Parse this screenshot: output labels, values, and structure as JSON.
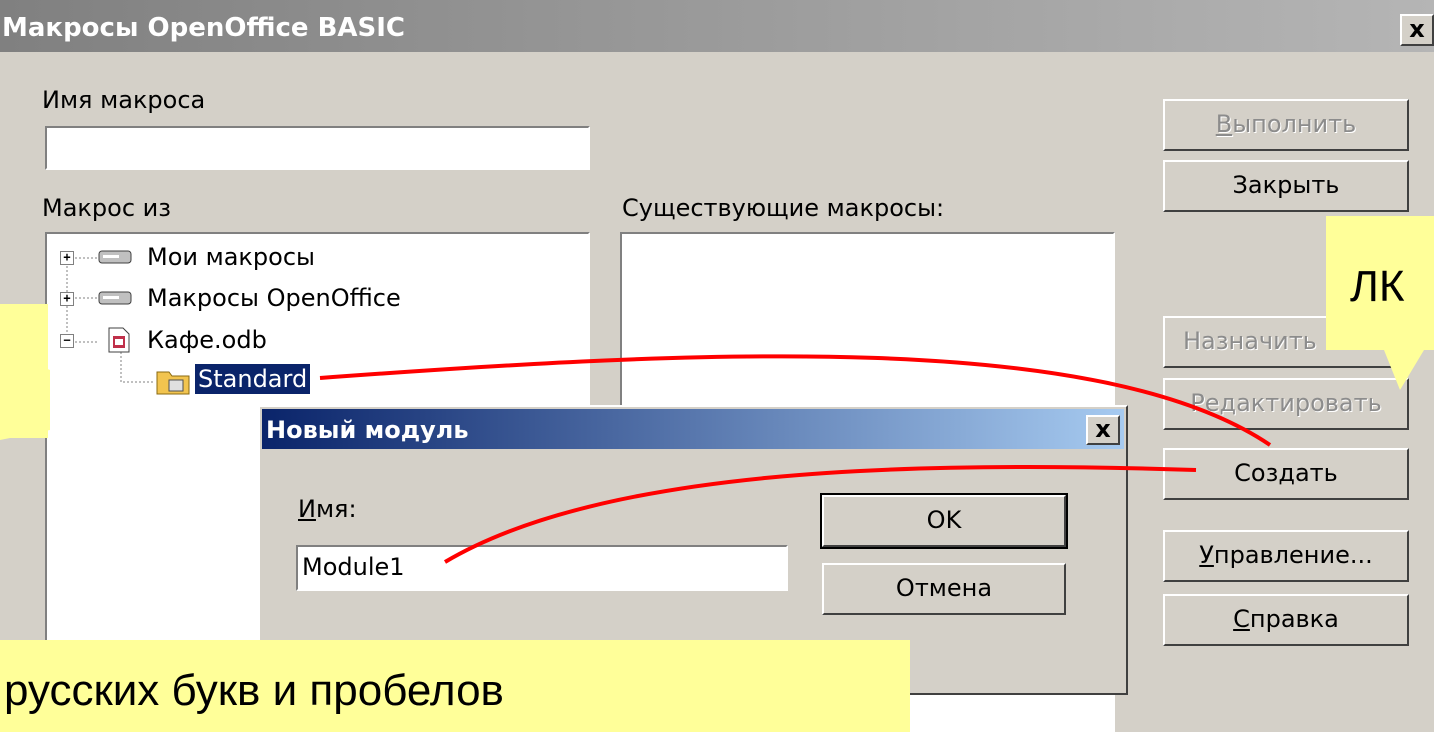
{
  "window": {
    "title": "Макросы OpenOffice BASIC",
    "close": "x"
  },
  "macro_name": {
    "label": "Имя макроса",
    "value": ""
  },
  "macro_from": {
    "label": "Макрос из"
  },
  "existing": {
    "label": "Существующие макросы:"
  },
  "tree": [
    {
      "label": "Мои макросы",
      "expander": "+"
    },
    {
      "label": "Макросы OpenOffice",
      "expander": "+"
    },
    {
      "label": "Кафе.odb",
      "expander": "−"
    },
    {
      "label": "Standard"
    }
  ],
  "buttons": {
    "run": "Выполнить",
    "close": "Закрыть",
    "assign": "Назначить",
    "edit": "Редактировать",
    "create": "Создать",
    "manage": "Управление...",
    "help": "Справка"
  },
  "new_module": {
    "title": "Новый модуль",
    "name_label": "Имя:",
    "name_value": "Module1",
    "ok": "OK",
    "cancel": "Отмена",
    "close": "x"
  },
  "callouts": {
    "bottom": "русских букв и пробелов",
    "top_right": "ЛК"
  },
  "colors": {
    "callout": "#ffff99",
    "arrow": "#ff0000",
    "selection": "#0a246a"
  }
}
